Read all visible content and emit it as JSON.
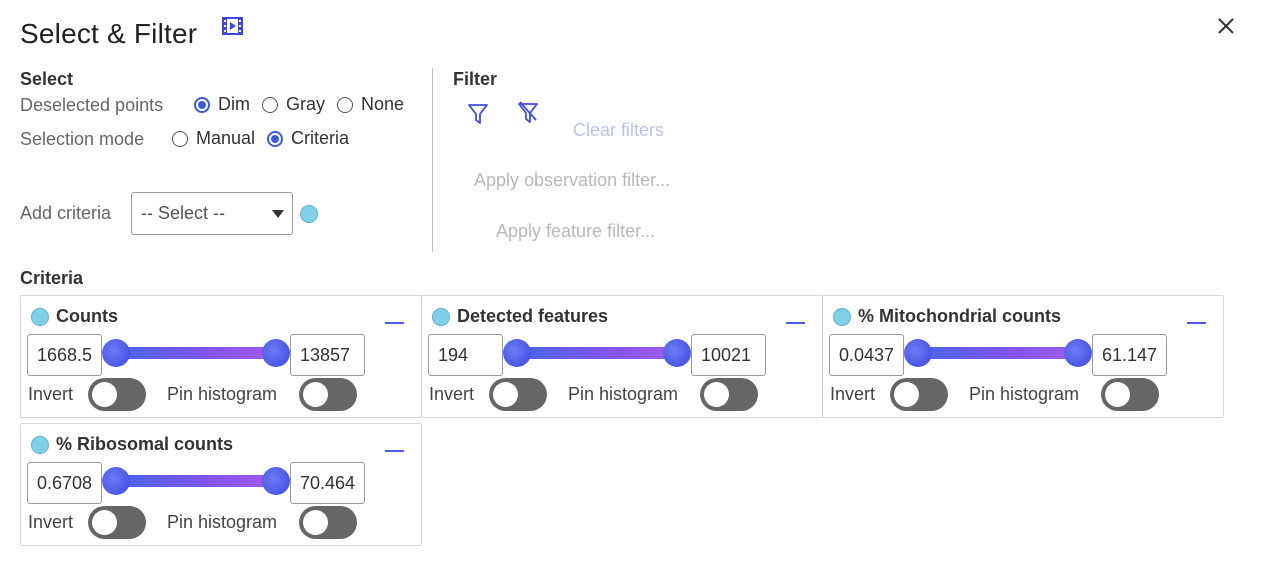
{
  "header": {
    "title": "Select & Filter",
    "video_icon": "video-icon",
    "close_icon": "close-icon"
  },
  "select": {
    "heading": "Select",
    "deselected_label": "Deselected points",
    "deselected_options": [
      "Dim",
      "Gray",
      "None"
    ],
    "deselected_value": "Dim",
    "mode_label": "Selection mode",
    "mode_options": [
      "Manual",
      "Criteria"
    ],
    "mode_value": "Criteria",
    "add_criteria_label": "Add criteria",
    "add_criteria_select": "-- Select --"
  },
  "filter": {
    "heading": "Filter",
    "filter_icon": "filter-icon",
    "filter_off_icon": "filter-off-icon",
    "clear_filters": "Clear filters",
    "apply_observation": "Apply observation filter...",
    "apply_feature": "Apply feature filter..."
  },
  "criteria": {
    "heading": "Criteria",
    "invert_label": "Invert",
    "pin_label": "Pin histogram",
    "cards": [
      {
        "name": "Counts",
        "min": "1668.5",
        "max": "13857"
      },
      {
        "name": "Detected features",
        "min": "194",
        "max": "10021"
      },
      {
        "name": "% Mitochondrial counts",
        "min": "0.0437",
        "max": "61.147"
      },
      {
        "name": "% Ribosomal counts",
        "min": "0.6708",
        "max": "70.464"
      }
    ]
  },
  "colors": {
    "accent": "#3b5bdb",
    "dot": "#7fd0e8",
    "toggle_off": "#666666",
    "disabled_text": "#b8b8b8"
  }
}
